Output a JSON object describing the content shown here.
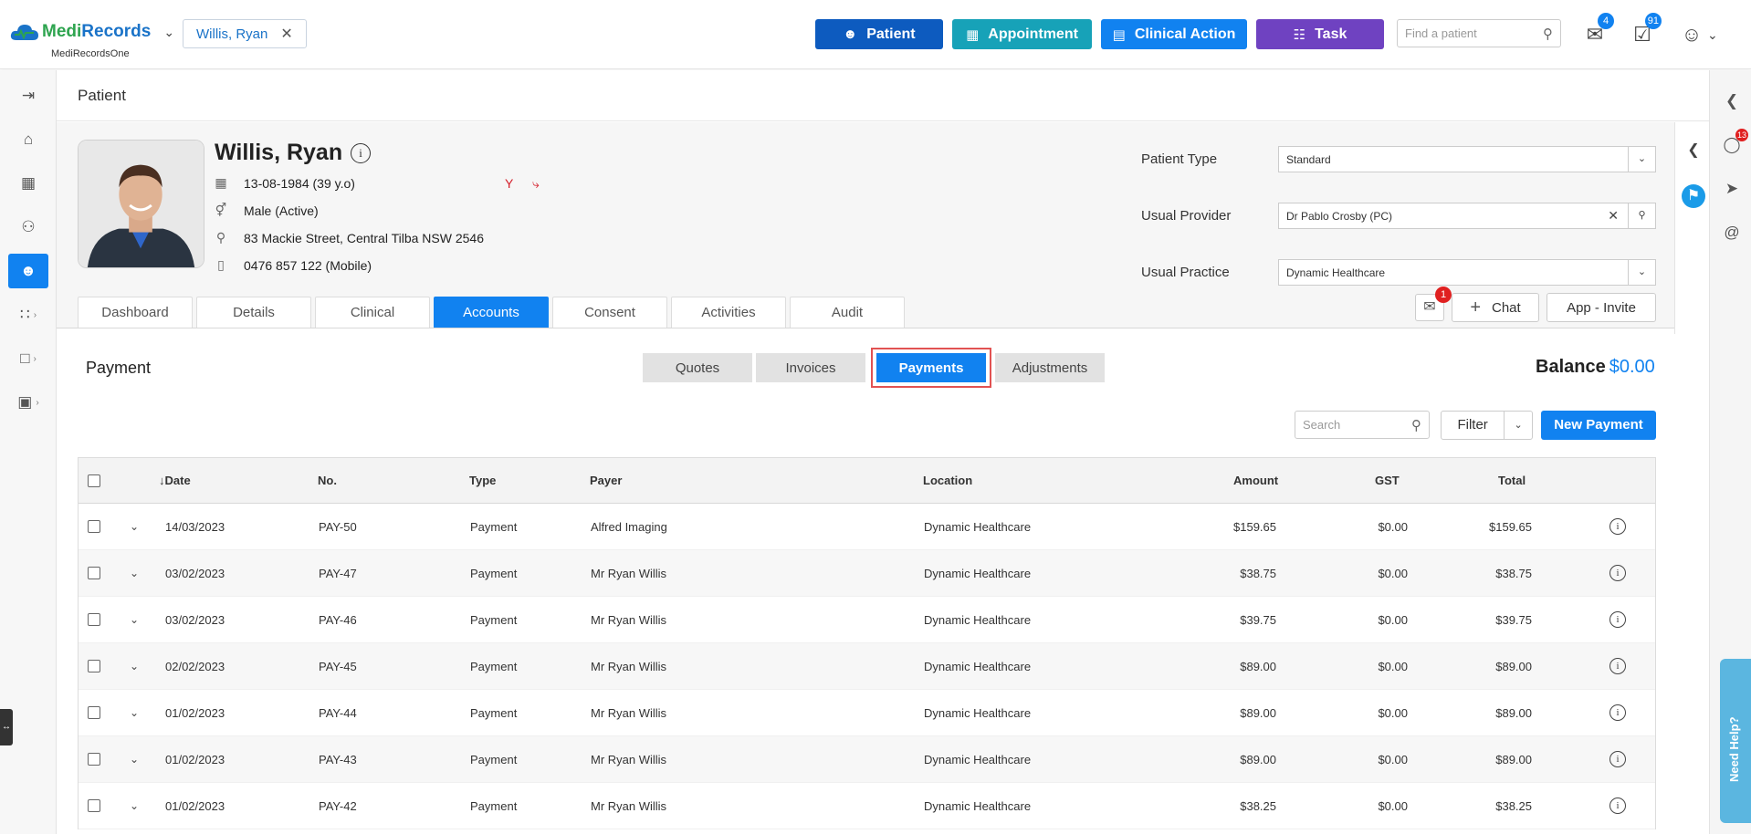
{
  "header": {
    "brand_part1": "Medi",
    "brand_part2": "Records",
    "brand_sub": "MediRecordsOne",
    "patient_chip": "Willis, Ryan",
    "buttons": {
      "patient": "Patient",
      "appointment": "Appointment",
      "clinical_action": "Clinical Action",
      "task": "Task"
    },
    "find_patient_placeholder": "Find a patient",
    "mail_badge": "4",
    "tasks_badge": "91"
  },
  "page": {
    "title": "Patient"
  },
  "patient": {
    "name": "Willis, Ryan",
    "dob": "13-08-1984 (39 y.o)",
    "gender": "Male (Active)",
    "address": "83 Mackie Street, Central Tilba NSW 2546",
    "phone": "0476 857 122 (Mobile)",
    "patient_type_label": "Patient Type",
    "patient_type_value": "Standard",
    "usual_provider_label": "Usual Provider",
    "usual_provider_value": "Dr Pablo Crosby (PC)",
    "usual_practice_label": "Usual Practice",
    "usual_practice_value": "Dynamic Healthcare"
  },
  "patient_tabs": [
    "Dashboard",
    "Details",
    "Clinical",
    "Accounts",
    "Consent",
    "Activities",
    "Audit"
  ],
  "active_patient_tab": "Accounts",
  "actions": {
    "message_badge": "1",
    "chat": "Chat",
    "app_invite": "App - Invite"
  },
  "right_rail": {
    "notifications_badge": "13",
    "need_help": "Need Help?"
  },
  "payments": {
    "section_title": "Payment",
    "segments": [
      "Quotes",
      "Invoices",
      "Payments",
      "Adjustments"
    ],
    "active_segment": "Payments",
    "balance_label": "Balance",
    "balance_value": "$0.00",
    "search_placeholder": "Search",
    "filter_label": "Filter",
    "new_payment": "New Payment",
    "columns": {
      "date": "Date",
      "no": "No.",
      "type": "Type",
      "payer": "Payer",
      "location": "Location",
      "amount": "Amount",
      "gst": "GST",
      "total": "Total"
    },
    "rows": [
      {
        "date": "14/03/2023",
        "no": "PAY-50",
        "type": "Payment",
        "payer": "Alfred Imaging",
        "location": "Dynamic Healthcare",
        "amount": "$159.65",
        "gst": "$0.00",
        "total": "$159.65"
      },
      {
        "date": "03/02/2023",
        "no": "PAY-47",
        "type": "Payment",
        "payer": "Mr Ryan Willis",
        "location": "Dynamic Healthcare",
        "amount": "$38.75",
        "gst": "$0.00",
        "total": "$38.75"
      },
      {
        "date": "03/02/2023",
        "no": "PAY-46",
        "type": "Payment",
        "payer": "Mr Ryan Willis",
        "location": "Dynamic Healthcare",
        "amount": "$39.75",
        "gst": "$0.00",
        "total": "$39.75"
      },
      {
        "date": "02/02/2023",
        "no": "PAY-45",
        "type": "Payment",
        "payer": "Mr Ryan Willis",
        "location": "Dynamic Healthcare",
        "amount": "$89.00",
        "gst": "$0.00",
        "total": "$89.00"
      },
      {
        "date": "01/02/2023",
        "no": "PAY-44",
        "type": "Payment",
        "payer": "Mr Ryan Willis",
        "location": "Dynamic Healthcare",
        "amount": "$89.00",
        "gst": "$0.00",
        "total": "$89.00"
      },
      {
        "date": "01/02/2023",
        "no": "PAY-43",
        "type": "Payment",
        "payer": "Mr Ryan Willis",
        "location": "Dynamic Healthcare",
        "amount": "$89.00",
        "gst": "$0.00",
        "total": "$89.00"
      },
      {
        "date": "01/02/2023",
        "no": "PAY-42",
        "type": "Payment",
        "payer": "Mr Ryan Willis",
        "location": "Dynamic Healthcare",
        "amount": "$38.25",
        "gst": "$0.00",
        "total": "$38.25"
      }
    ]
  },
  "colors": {
    "primary": "#1182f0",
    "patient_btn": "#0d5bbf",
    "appointment_btn": "#17a2b8",
    "task_btn": "#6f42c1",
    "highlight_outline": "#e25252"
  }
}
